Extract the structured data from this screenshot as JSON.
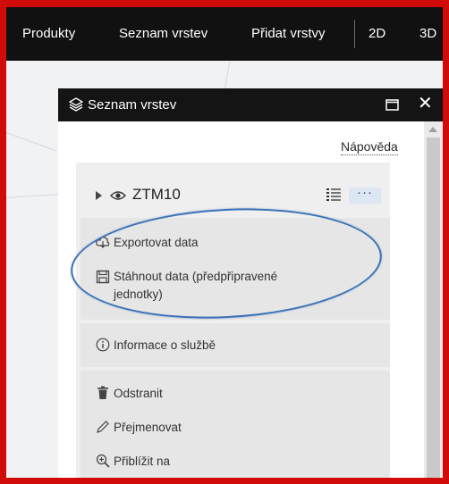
{
  "topbar": {
    "items": [
      "Produkty",
      "Seznam vrstev",
      "Přidat vrstvy",
      "2D",
      "3D"
    ]
  },
  "panel": {
    "title": "Seznam vrstev",
    "help_link": "Nápověda",
    "icons": {
      "header": "layers-icon",
      "maximize": "maximize-icon",
      "close": "close-icon"
    }
  },
  "layer": {
    "name": "ZTM10",
    "more_label": "···",
    "icons": [
      "chevron-right-icon",
      "eye-icon",
      "legend-list-icon"
    ]
  },
  "menu": {
    "export_label": "Exportovat data",
    "download_label_line1": "Stáhnout data (předpřipravené",
    "download_label_line2": "jednotky)",
    "info_label": "Informace o službě",
    "remove_label": "Odstranit",
    "rename_label": "Přejmenovat",
    "zoom_label": "Přiblížit na"
  },
  "colors": {
    "frame": "#d10a0a",
    "topbar": "#111111",
    "highlight_ellipse": "#3a72b6",
    "more_button_bg": "#dde6f3"
  }
}
